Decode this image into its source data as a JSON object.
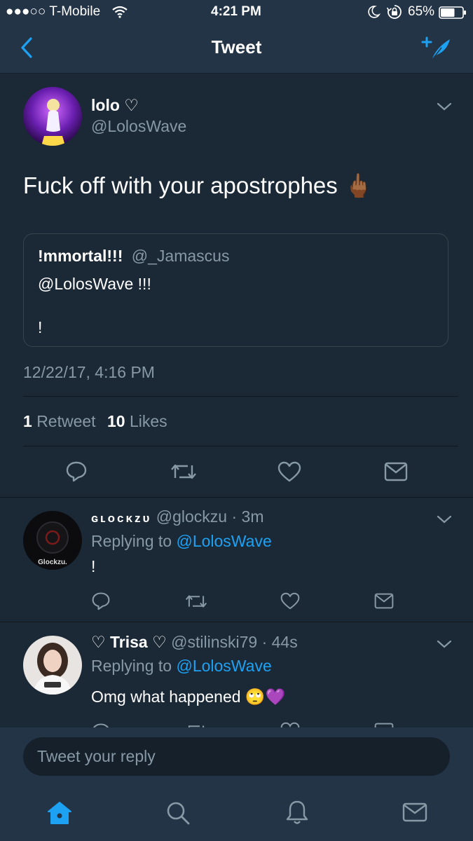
{
  "status_bar": {
    "carrier": "●●●○○ T-Mobile",
    "time": "4:21 PM",
    "battery_percent": "65%",
    "battery_level": 0.65
  },
  "nav": {
    "title": "Tweet",
    "back_icon": "chevron-left-icon",
    "compose_icon": "compose-tweet-icon"
  },
  "tweet": {
    "display_name": "lolo ♡",
    "handle": "@LolosWave",
    "text": "Fuck off with your apostrophes 🖕🏾",
    "quoted": {
      "display_name": "!mmortal!!!",
      "handle": "@_Jamascus",
      "line1": "@LolosWave !!!",
      "line2": "!"
    },
    "timestamp": "12/22/17, 4:16 PM",
    "retweet_count": "1",
    "retweet_label": "Retweet",
    "like_count": "10",
    "like_label": "Likes"
  },
  "replies": [
    {
      "display_name": "ɢʟᴏᴄᴋᴢᴜ",
      "handle": "@glockzu",
      "time": "· 3m",
      "replying_prefix": "Replying to",
      "replying_to": "@LolosWave",
      "text": "!",
      "avatar_label": "Glockzu."
    },
    {
      "display_name": "♡ Trisa ♡",
      "handle": "@stilinski79",
      "time": "· 44s",
      "replying_prefix": "Replying to",
      "replying_to": "@LolosWave",
      "text": "Omg what happened 🙄💜"
    }
  ],
  "composer": {
    "placeholder": "Tweet your reply"
  },
  "tabs": [
    {
      "name": "home",
      "icon": "home-icon",
      "active": true
    },
    {
      "name": "search",
      "icon": "search-icon",
      "active": false
    },
    {
      "name": "notifications",
      "icon": "bell-icon",
      "active": false
    },
    {
      "name": "messages",
      "icon": "envelope-icon",
      "active": false
    }
  ],
  "colors": {
    "background": "#1b2836",
    "bar": "#243447",
    "accent": "#1da1f2",
    "muted": "#8899a6"
  }
}
